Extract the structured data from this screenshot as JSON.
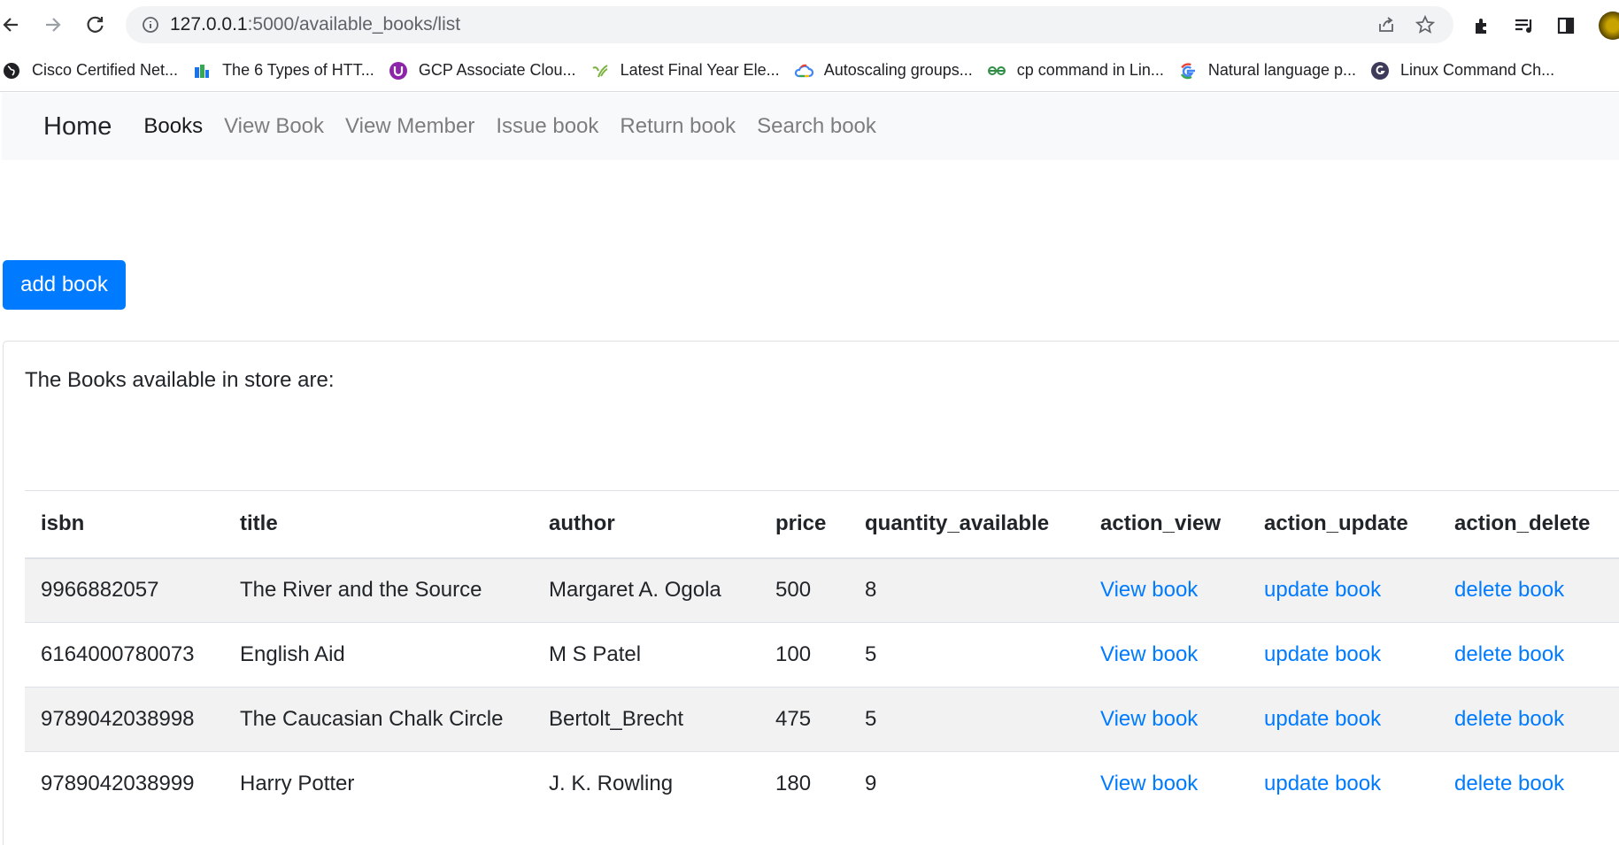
{
  "browser": {
    "url_host": "127.0.0.1",
    "url_path": ":5000/available_books/list",
    "bookmarks": [
      {
        "label": "Cisco Certified Net...",
        "icon": "globe-icon",
        "color": "#202124"
      },
      {
        "label": "The 6 Types of HTT...",
        "icon": "bars-icon",
        "color": "#1a73e8"
      },
      {
        "label": "GCP Associate Clou...",
        "icon": "u-icon",
        "color": "#8e24aa"
      },
      {
        "label": "Latest Final Year Ele...",
        "icon": "leaf-icon",
        "color": "#7cb342"
      },
      {
        "label": "Autoscaling groups...",
        "icon": "cloud-icon",
        "color": "#4285f4"
      },
      {
        "label": "cp command in Lin...",
        "icon": "gfg-icon",
        "color": "#2f8d46"
      },
      {
        "label": "Natural language p...",
        "icon": "google-icon",
        "color": "#4285f4"
      },
      {
        "label": "Linux Command Ch...",
        "icon": "g-circle-icon",
        "color": "#3c3c5a"
      }
    ]
  },
  "navbar": {
    "brand": "Home",
    "links": [
      "Books",
      "View Book",
      "View Member",
      "Issue book",
      "Return book",
      "Search book"
    ]
  },
  "add_button": "add book",
  "card_text": "The Books available in store are:",
  "table": {
    "headers": [
      "isbn",
      "title",
      "author",
      "price",
      "quantity_available",
      "action_view",
      "action_update",
      "action_delete"
    ],
    "rows": [
      [
        "9966882057",
        "The River and the Source",
        "Margaret A. Ogola",
        "500",
        "8",
        "View book",
        "update book",
        "delete book"
      ],
      [
        "6164000780073",
        "English Aid",
        "M S Patel",
        "100",
        "5",
        "View book",
        "update book",
        "delete book"
      ],
      [
        "9789042038998",
        "The Caucasian Chalk Circle",
        "Bertolt_Brecht",
        "475",
        "5",
        "View book",
        "update book",
        "delete book"
      ],
      [
        "9789042038999",
        "Harry Potter",
        "J. K. Rowling",
        "180",
        "9",
        "View book",
        "update book",
        "delete book"
      ]
    ]
  },
  "colors": {
    "primary": "#007bff",
    "navbar_bg": "#f8f9fa"
  }
}
